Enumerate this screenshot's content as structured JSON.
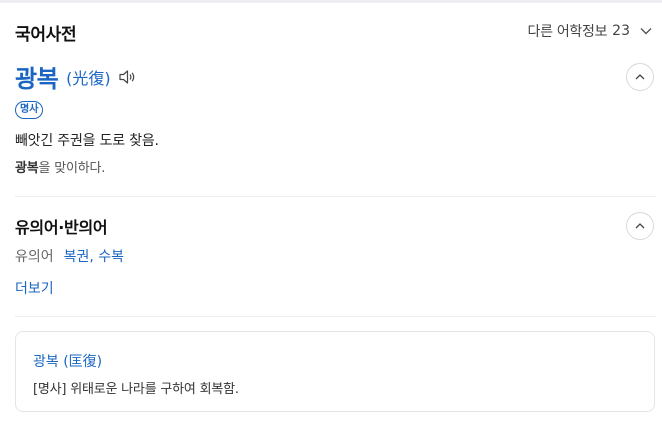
{
  "header": {
    "title": "국어사전",
    "more_label": "다른 어학정보",
    "more_count": "23"
  },
  "entry": {
    "headword": "광복",
    "hanja": "(光復)",
    "pos": "명사",
    "definition": "빼앗긴 주권을 도로 찾음.",
    "example_bold": "광복",
    "example_rest": "을 맞이하다."
  },
  "related": {
    "title": "유의어·반의어",
    "synonym_label": "유의어",
    "synonyms": "복권, 수복",
    "more_label": "더보기"
  },
  "card": {
    "title": "광복 (匡復)",
    "definition": "[명사] 위태로운 나라를 구하여 회복함."
  },
  "colors": {
    "accent": "#1a66c2",
    "divider": "#eceef1"
  },
  "icons": {
    "header_more": "chevron-down-icon",
    "speaker": "speaker-icon",
    "collapse": "chevron-up-icon"
  }
}
